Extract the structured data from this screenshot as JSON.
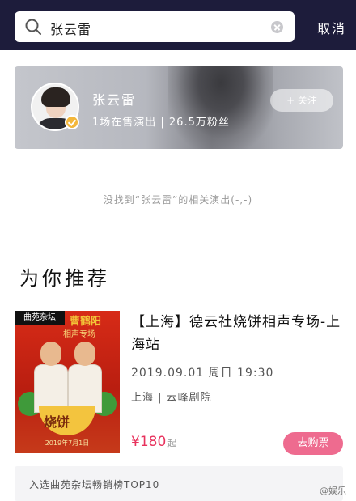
{
  "search": {
    "query": "张云雷",
    "cancel_label": "取消"
  },
  "artist": {
    "name": "张云雷",
    "stats": "1场在售演出 | 26.5万粉丝",
    "follow_label": "+ 关注"
  },
  "no_result_text": "没找到“张云雷”的相关演出(-,-)",
  "section_title": "为你推荐",
  "show": {
    "poster_tag": "曲苑杂坛",
    "poster_title": "曹鹤阳",
    "poster_subtitle": "相声专场",
    "poster_name": "烧饼",
    "poster_date": "2019年7月1日",
    "title": "【上海】德云社烧饼相声专场-上海站",
    "date": "2019.09.01 周日 19:30",
    "venue": "上海 | 云峰剧院",
    "price": "¥180",
    "price_suffix": "起",
    "buy_label": "去购票"
  },
  "rank_banner": "入选曲苑杂坛畅销榜TOP10",
  "watermark": "@娱乐"
}
